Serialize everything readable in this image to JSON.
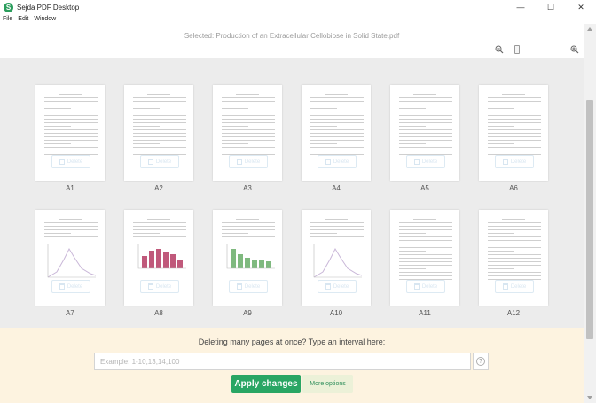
{
  "window": {
    "logo_letter": "S",
    "title": "Sejda PDF Desktop",
    "minimize_glyph": "—",
    "maximize_glyph": "☐",
    "close_glyph": "✕"
  },
  "menu": [
    "File",
    "Edit",
    "Window"
  ],
  "header": {
    "selected_file": "Selected: Production of an Extracellular Cellobiose in Solid State.pdf"
  },
  "zoom": {
    "level_fraction": 0.25
  },
  "pages": [
    {
      "label": "A1",
      "delete_label": "Delete"
    },
    {
      "label": "A2",
      "delete_label": "Delete"
    },
    {
      "label": "A3",
      "delete_label": "Delete"
    },
    {
      "label": "A4",
      "delete_label": "Delete"
    },
    {
      "label": "A5",
      "delete_label": "Delete"
    },
    {
      "label": "A6",
      "delete_label": "Delete"
    },
    {
      "label": "A7",
      "delete_label": "Delete"
    },
    {
      "label": "A8",
      "delete_label": "Delete"
    },
    {
      "label": "A9",
      "delete_label": "Delete"
    },
    {
      "label": "A10",
      "delete_label": "Delete"
    },
    {
      "label": "A11",
      "delete_label": "Delete"
    },
    {
      "label": "A12",
      "delete_label": "Delete"
    }
  ],
  "bottom": {
    "prompt": "Deleting many pages at once? Type an interval here:",
    "interval_placeholder": "Example: 1-10,13,14,100",
    "help_glyph": "?",
    "apply_label": "Apply changes",
    "more_options_label": "More options"
  },
  "colors": {
    "accent_green": "#29a664",
    "bar_red": "#b0305a",
    "bar_green": "#5fa85f",
    "panel_bg": "#fdf3e0"
  }
}
